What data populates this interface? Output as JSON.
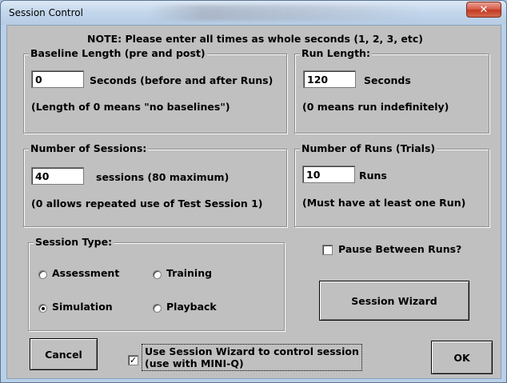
{
  "window": {
    "title": "Session Control",
    "close_glyph": "✕"
  },
  "note": "NOTE: Please enter all times as whole seconds (1, 2, 3, etc)",
  "baseline": {
    "legend": "Baseline Length (pre and post)",
    "value": "0",
    "units": "Seconds (before and after Runs)",
    "hint": "(Length of 0 means \"no baselines\")"
  },
  "run_length": {
    "legend": "Run Length:",
    "value": "120",
    "units": "Seconds",
    "hint": "(0 means run indefinitely)"
  },
  "sessions": {
    "legend": "Number of Sessions:",
    "value": "40",
    "units": "sessions (80 maximum)",
    "hint": "(0 allows repeated use of Test Session 1)"
  },
  "runs": {
    "legend": "Number of Runs (Trials)",
    "value": "10",
    "units": "Runs",
    "hint": "(Must have at least one Run)"
  },
  "session_type": {
    "legend": "Session Type:",
    "options": [
      {
        "label": "Assessment",
        "selected": false
      },
      {
        "label": "Training",
        "selected": false
      },
      {
        "label": "Simulation",
        "selected": true
      },
      {
        "label": "Playback",
        "selected": false
      }
    ]
  },
  "pause_between_runs": {
    "label": "Pause Between Runs?",
    "checked": false
  },
  "session_wizard_button": "Session Wizard",
  "use_wizard": {
    "line1": "Use Session Wizard to control session",
    "line2": "(use with MINI-Q)",
    "checked": true,
    "check_glyph": "✓"
  },
  "buttons": {
    "cancel": "Cancel",
    "ok": "OK"
  }
}
